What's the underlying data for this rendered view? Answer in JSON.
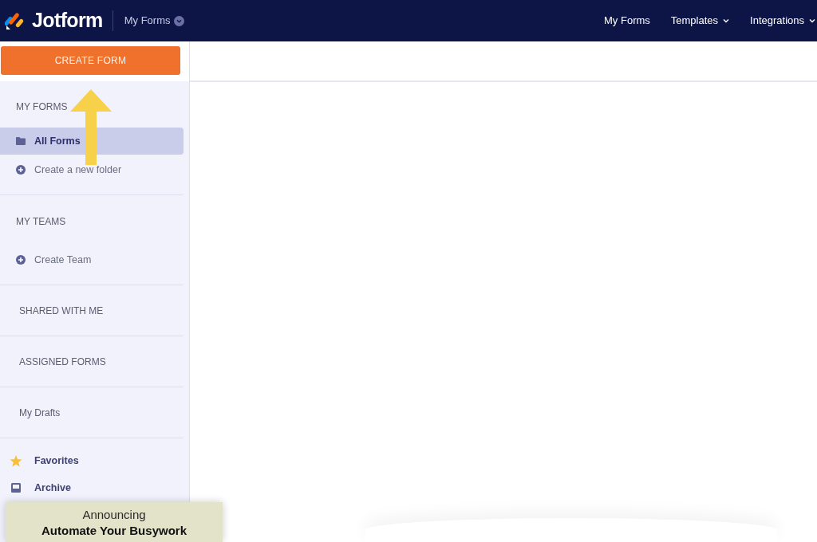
{
  "header": {
    "logo": "Jotform",
    "breadcrumb": "My Forms",
    "nav": [
      {
        "label": "My Forms",
        "dropdown": false
      },
      {
        "label": "Templates",
        "dropdown": true
      },
      {
        "label": "Integrations",
        "dropdown": true
      }
    ]
  },
  "create_button": "CREATE FORM",
  "sidebar": {
    "groups": [
      {
        "heading": "MY FORMS",
        "items": [
          {
            "label": "All Forms",
            "kind": "folder",
            "selected": true
          },
          {
            "label": "Create a new folder",
            "kind": "add",
            "selected": false
          }
        ]
      },
      {
        "heading": "MY TEAMS",
        "items": [
          {
            "label": "Create Team",
            "kind": "add",
            "selected": false
          }
        ]
      },
      {
        "heading": "SHARED WITH ME"
      },
      {
        "heading": "ASSIGNED FORMS"
      },
      {
        "heading": "My Drafts"
      }
    ],
    "links": [
      {
        "label": "Favorites",
        "kind": "star",
        "selected": false
      },
      {
        "label": "Archive",
        "kind": "archive",
        "selected": false
      }
    ]
  },
  "announcement": {
    "title": "Announcing",
    "headline": "Automate Your Busywork"
  }
}
